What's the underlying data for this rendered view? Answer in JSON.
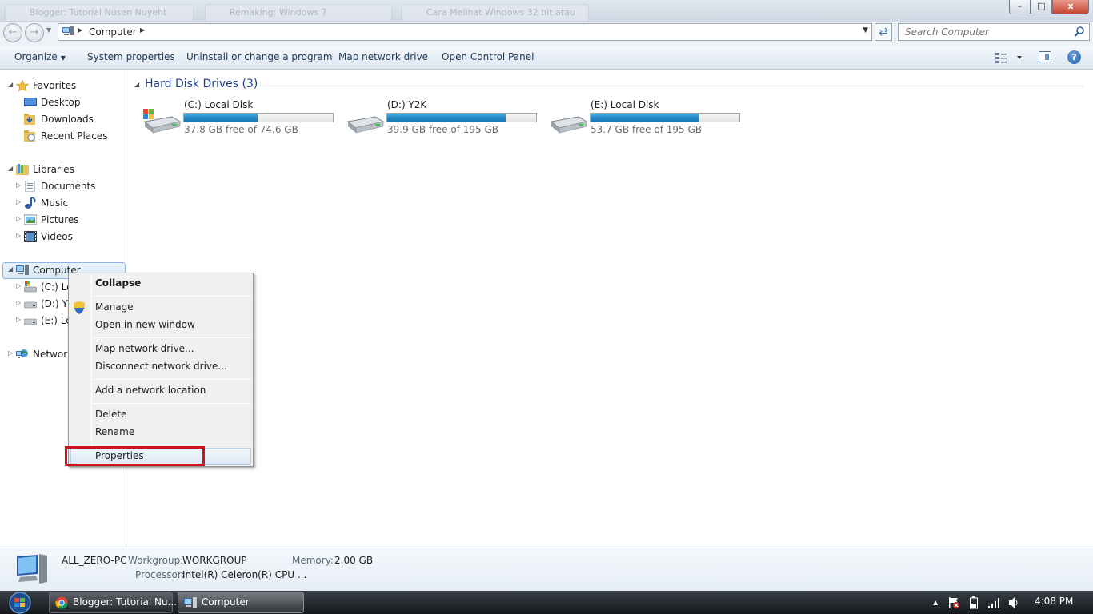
{
  "window": {
    "background_tabs": [
      "Blogger: Tutorial Nusen Nuyeht",
      "Remaking: Windows 7",
      "Cara Melihat Windows 32 bit atau"
    ],
    "controls": {
      "minimize": "–",
      "maximize": "□",
      "close": "x"
    }
  },
  "address": {
    "path": "Computer",
    "search_placeholder": "Search Computer"
  },
  "toolbar": {
    "organize": "Organize",
    "system_properties": "System properties",
    "uninstall": "Uninstall or change a program",
    "map_drive": "Map network drive",
    "control_panel": "Open Control Panel",
    "help": "?"
  },
  "nav": {
    "favorites": "Favorites",
    "desktop": "Desktop",
    "downloads": "Downloads",
    "recent": "Recent Places",
    "libraries": "Libraries",
    "documents": "Documents",
    "music": "Music",
    "pictures": "Pictures",
    "videos": "Videos",
    "computer": "Computer",
    "drive_c": "(C:) Lo",
    "drive_d": "(D:) Y2",
    "drive_e": "(E:) Lo",
    "network": "Network"
  },
  "content": {
    "group_header": "Hard Disk Drives (3)",
    "drives": [
      {
        "name": "(C:) Local Disk",
        "free": "37.8 GB free of 74.6 GB",
        "used_fraction": 0.493
      },
      {
        "name": "(D:) Y2K",
        "free": "39.9 GB free of 195 GB",
        "used_fraction": 0.795
      },
      {
        "name": "(E:) Local Disk",
        "free": "53.7 GB free of 195 GB",
        "used_fraction": 0.725
      }
    ]
  },
  "details": {
    "computer_name": "ALL_ZERO-PC",
    "workgroup_label": "Workgroup:",
    "workgroup": "WORKGROUP",
    "memory_label": "Memory:",
    "memory": "2.00 GB",
    "processor_label": "Processor:",
    "processor": "Intel(R) Celeron(R) CPU ..."
  },
  "context_menu": {
    "collapse": "Collapse",
    "manage": "Manage",
    "open_new": "Open in new window",
    "map": "Map network drive...",
    "disconnect": "Disconnect network drive...",
    "add_location": "Add a network location",
    "delete": "Delete",
    "rename": "Rename",
    "properties": "Properties"
  },
  "taskbar": {
    "chrome_task": "Blogger: Tutorial Nu...",
    "explorer_task": "Computer",
    "clock": "4:08 PM"
  },
  "colors": {
    "accent": "#1e3f8f",
    "highlight_box": "#d0121b",
    "bar_fill": "#2689c7"
  }
}
